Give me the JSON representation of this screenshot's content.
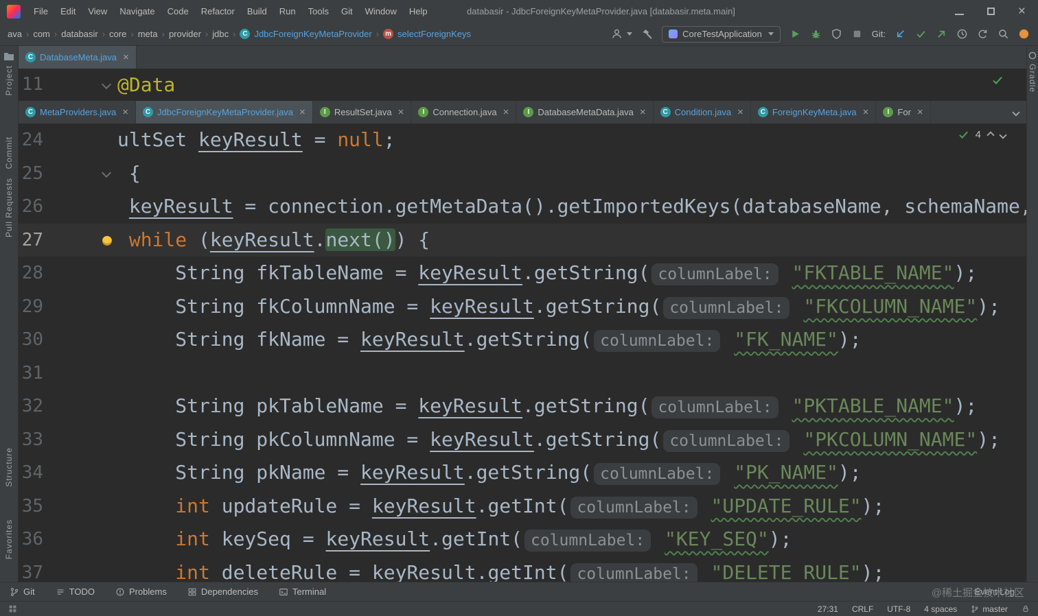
{
  "titlebar": {
    "title": "databasir - JdbcForeignKeyMetaProvider.java [databasir.meta.main]",
    "menus": [
      "File",
      "Edit",
      "View",
      "Navigate",
      "Code",
      "Refactor",
      "Build",
      "Run",
      "Tools",
      "Git",
      "Window",
      "Help"
    ]
  },
  "navbar": {
    "path": [
      "ava",
      "com",
      "databasir",
      "core",
      "meta",
      "provider",
      "jdbc"
    ],
    "class_name": "JdbcForeignKeyMetaProvider",
    "method_name": "selectForeignKeys",
    "run_config": "CoreTestApplication",
    "git_label": "Git:"
  },
  "icons": {
    "class_letter": "C",
    "interface_letter": "I",
    "method_letter": "m"
  },
  "left_stripe": {
    "project": "Project",
    "commit": "Commit",
    "pull_requests": "Pull Requests",
    "structure": "Structure",
    "favorites": "Favorites"
  },
  "right_stripe": {
    "gradle": "Gradle"
  },
  "top_editor": {
    "tab": "DatabaseMeta.java",
    "line": {
      "num": "11",
      "indent": 0,
      "fold": true,
      "tokens": [
        [
          "a",
          "@Data"
        ]
      ]
    }
  },
  "tab_bar": {
    "tabs": [
      {
        "label": "MetaProviders.java",
        "kind": "class",
        "blue": true
      },
      {
        "label": "JdbcForeignKeyMetaProvider.java",
        "kind": "class",
        "blue": true,
        "selected": true
      },
      {
        "label": "ResultSet.java",
        "kind": "interface",
        "blue": false
      },
      {
        "label": "Connection.java",
        "kind": "interface",
        "blue": false
      },
      {
        "label": "DatabaseMetaData.java",
        "kind": "interface",
        "blue": false
      },
      {
        "label": "Condition.java",
        "kind": "class",
        "blue": true
      },
      {
        "label": "ForeignKeyMeta.java",
        "kind": "class",
        "blue": true
      },
      {
        "label": "For",
        "kind": "interface",
        "blue": false
      }
    ]
  },
  "editor": {
    "inspection_count": "4",
    "lines": [
      {
        "num": "24",
        "indent": 0,
        "tokens": [
          [
            "p",
            "ultSet "
          ],
          [
            "u",
            "keyResult"
          ],
          [
            "p",
            " = "
          ],
          [
            "k",
            "null"
          ],
          [
            "p",
            ";"
          ]
        ]
      },
      {
        "num": "25",
        "indent": 1,
        "fold": true,
        "tokens": [
          [
            "p",
            "{"
          ]
        ]
      },
      {
        "num": "26",
        "indent": 1,
        "tokens": [
          [
            "u",
            "keyResult"
          ],
          [
            "p",
            " = connection.getMetaData().getImportedKeys(databaseName, schemaName,"
          ]
        ]
      },
      {
        "num": "27",
        "indent": 1,
        "current": true,
        "bulb": true,
        "tokens": [
          [
            "k",
            "while"
          ],
          [
            "p",
            " ("
          ],
          [
            "u",
            "keyResult"
          ],
          [
            "p",
            "."
          ],
          [
            "m",
            "next()"
          ],
          [
            "p",
            ") {"
          ]
        ]
      },
      {
        "num": "28",
        "indent": 5,
        "tokens": [
          [
            "p",
            "String fkTableName = "
          ],
          [
            "u",
            "keyResult"
          ],
          [
            "p",
            ".getString("
          ],
          [
            "h",
            "columnLabel:"
          ],
          [
            "p",
            " "
          ],
          [
            "s",
            "\"FKTABLE_NAME\""
          ],
          [
            "p",
            ");"
          ]
        ]
      },
      {
        "num": "29",
        "indent": 5,
        "tokens": [
          [
            "p",
            "String fkColumnName = "
          ],
          [
            "u",
            "keyResult"
          ],
          [
            "p",
            ".getString("
          ],
          [
            "h",
            "columnLabel:"
          ],
          [
            "p",
            " "
          ],
          [
            "s",
            "\"FKCOLUMN_NAME\""
          ],
          [
            "p",
            ");"
          ]
        ]
      },
      {
        "num": "30",
        "indent": 5,
        "tokens": [
          [
            "p",
            "String fkName = "
          ],
          [
            "u",
            "keyResult"
          ],
          [
            "p",
            ".getString("
          ],
          [
            "h",
            "columnLabel:"
          ],
          [
            "p",
            " "
          ],
          [
            "s",
            "\"FK_NAME\""
          ],
          [
            "p",
            ");"
          ]
        ]
      },
      {
        "num": "31",
        "indent": 0,
        "tokens": []
      },
      {
        "num": "32",
        "indent": 5,
        "tokens": [
          [
            "p",
            "String pkTableName = "
          ],
          [
            "u",
            "keyResult"
          ],
          [
            "p",
            ".getString("
          ],
          [
            "h",
            "columnLabel:"
          ],
          [
            "p",
            " "
          ],
          [
            "s",
            "\"PKTABLE_NAME\""
          ],
          [
            "p",
            ");"
          ]
        ]
      },
      {
        "num": "33",
        "indent": 5,
        "tokens": [
          [
            "p",
            "String pkColumnName = "
          ],
          [
            "u",
            "keyResult"
          ],
          [
            "p",
            ".getString("
          ],
          [
            "h",
            "columnLabel:"
          ],
          [
            "p",
            " "
          ],
          [
            "s",
            "\"PKCOLUMN_NAME\""
          ],
          [
            "p",
            ");"
          ]
        ]
      },
      {
        "num": "34",
        "indent": 5,
        "tokens": [
          [
            "p",
            "String pkName = "
          ],
          [
            "u",
            "keyResult"
          ],
          [
            "p",
            ".getString("
          ],
          [
            "h",
            "columnLabel:"
          ],
          [
            "p",
            " "
          ],
          [
            "s",
            "\"PK_NAME\""
          ],
          [
            "p",
            ");"
          ]
        ]
      },
      {
        "num": "35",
        "indent": 5,
        "tokens": [
          [
            "k",
            "int"
          ],
          [
            "p",
            " updateRule = "
          ],
          [
            "u",
            "keyResult"
          ],
          [
            "p",
            ".getInt("
          ],
          [
            "h",
            "columnLabel:"
          ],
          [
            "p",
            " "
          ],
          [
            "s",
            "\"UPDATE_RULE\""
          ],
          [
            "p",
            ");"
          ]
        ]
      },
      {
        "num": "36",
        "indent": 5,
        "tokens": [
          [
            "k",
            "int"
          ],
          [
            "p",
            " keySeq = "
          ],
          [
            "u",
            "keyResult"
          ],
          [
            "p",
            ".getInt("
          ],
          [
            "h",
            "columnLabel:"
          ],
          [
            "p",
            " "
          ],
          [
            "s",
            "\"KEY_SEQ\""
          ],
          [
            "p",
            ");"
          ]
        ]
      },
      {
        "num": "37",
        "indent": 5,
        "tokens": [
          [
            "k",
            "int"
          ],
          [
            "p",
            " deleteRule = "
          ],
          [
            "u",
            "keyResult"
          ],
          [
            "p",
            ".getInt("
          ],
          [
            "h",
            "columnLabel:"
          ],
          [
            "p",
            " "
          ],
          [
            "s",
            "\"DELETE_RULE\""
          ],
          [
            "p",
            ");"
          ]
        ]
      }
    ]
  },
  "bottom_bar": {
    "git": "Git",
    "todo": "TODO",
    "problems": "Problems",
    "dependencies": "Dependencies",
    "terminal": "Terminal",
    "event_log": "Event Log"
  },
  "status_bar": {
    "caret_position": "27:31",
    "line_separator": "CRLF",
    "encoding": "UTF-8",
    "indent": "4 spaces",
    "git_branch": "master"
  },
  "watermark": {
    "text": "@稀土掘金技术社区"
  },
  "colors": {
    "panel_bg": "#3C3F41",
    "editor_bg": "#2B2B2B",
    "keyword": "#CC7832",
    "string": "#6A8759",
    "annotation": "#BBB529",
    "tab_blue": "#56A3E0",
    "success_green": "#599E5E",
    "notification_orange": "#E8923C"
  }
}
